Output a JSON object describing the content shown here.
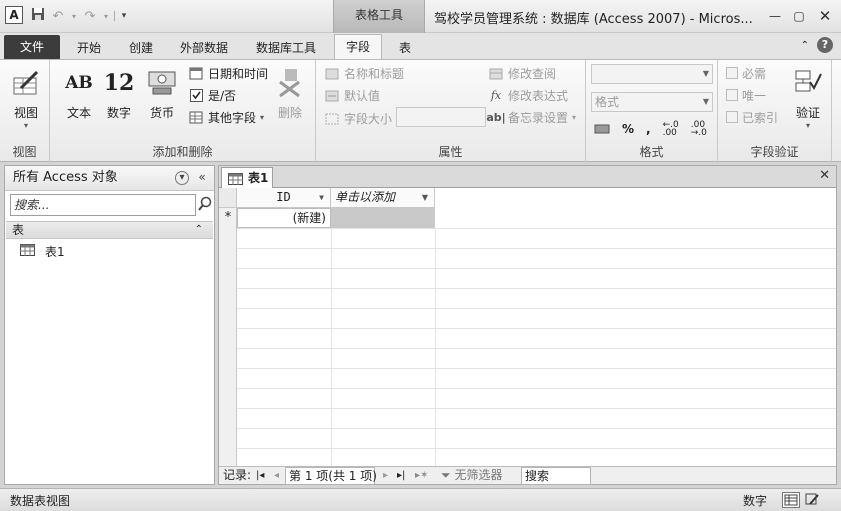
{
  "app": {
    "icon_letter": "A",
    "title": "驾校学员管理系统 : 数据库 (Access 2007)  -  Micros...",
    "context_tab_group": "表格工具"
  },
  "tabs": [
    {
      "label": "文件"
    },
    {
      "label": "开始"
    },
    {
      "label": "创建"
    },
    {
      "label": "外部数据"
    },
    {
      "label": "数据库工具"
    },
    {
      "label": "字段"
    },
    {
      "label": "表"
    }
  ],
  "ribbon": {
    "view_group": {
      "label": "视图",
      "view_button": "视图"
    },
    "add_delete_group": {
      "label": "添加和删除",
      "text_button": "文本",
      "text_icon": "AB",
      "number_button": "数字",
      "number_icon": "12",
      "currency_button": "货币",
      "datetime_button": "日期和时间",
      "yesno_button": "是/否",
      "more_fields_button": "其他字段",
      "delete_button": "删除"
    },
    "properties_group": {
      "label": "属性",
      "name_caption": "名称和标题",
      "default_value": "默认值",
      "field_size": "字段大小",
      "modify_lookups": "修改查阅",
      "modify_expression": "修改表达式",
      "memo_settings": "备忘录设置"
    },
    "format_group": {
      "label": "格式",
      "format_combo": "格式",
      "percent": "%",
      "comma": ","
    },
    "validation_group": {
      "label": "字段验证",
      "required": "必需",
      "unique": "唯一",
      "indexed": "已索引",
      "validation_button": "验证"
    }
  },
  "nav_pane": {
    "header": "所有 Access 对象",
    "search_placeholder": "搜索...",
    "group": "表",
    "items": [
      {
        "label": "表1"
      }
    ]
  },
  "document": {
    "tab_label": "表1",
    "columns": [
      {
        "label": "ID"
      },
      {
        "label": "单击以添加"
      }
    ],
    "new_row_marker": "*",
    "new_row_value": "(新建)"
  },
  "record_nav": {
    "label": "记录:",
    "position": "第 1 项(共 1 项)",
    "filter": "无筛选器",
    "search": "搜索"
  },
  "status_bar": {
    "left": "数据表视图",
    "mode": "数字"
  }
}
